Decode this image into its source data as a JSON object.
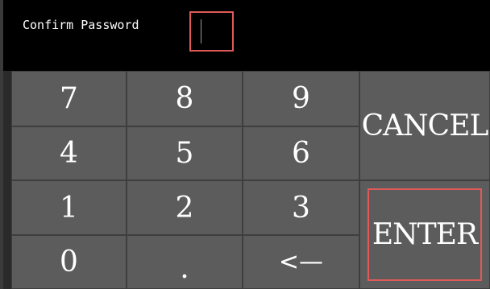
{
  "prompt": {
    "label": "Confirm Password",
    "value": ""
  },
  "keypad": {
    "rows": [
      [
        "7",
        "8",
        "9"
      ],
      [
        "4",
        "5",
        "6"
      ],
      [
        "1",
        "2",
        "3"
      ],
      [
        "0",
        ".",
        "<—"
      ]
    ],
    "cancel_label": "CANCEL",
    "enter_label": "ENTER"
  },
  "colors": {
    "header_bg": "#000000",
    "key_bg": "#5c5c5c",
    "focus_outline": "#e05a5a",
    "text": "#ffffff"
  }
}
